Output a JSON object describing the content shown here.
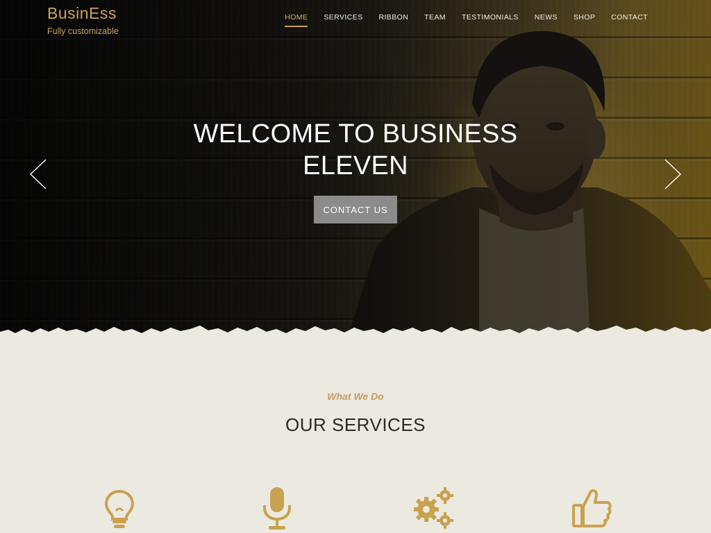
{
  "brand": {
    "title": "BusinEss",
    "tagline": "Fully customizable"
  },
  "nav": {
    "items": [
      {
        "label": "HOME",
        "active": true
      },
      {
        "label": "SERVICES",
        "active": false
      },
      {
        "label": "RIBBON",
        "active": false
      },
      {
        "label": "TEAM",
        "active": false
      },
      {
        "label": "TESTIMONIALS",
        "active": false
      },
      {
        "label": "NEWS",
        "active": false
      },
      {
        "label": "SHOP",
        "active": false
      },
      {
        "label": "CONTACT",
        "active": false
      }
    ]
  },
  "hero": {
    "title_line1": "WELCOME TO BUSINESS",
    "title_line2": "ELEVEN",
    "button_label": "CONTACT US"
  },
  "services": {
    "kicker": "What We Do",
    "title": "OUR SERVICES",
    "icons": [
      "lightbulb-icon",
      "microphone-icon",
      "gears-icon",
      "thumbs-up-icon"
    ]
  },
  "colors": {
    "accent": "#c9a24f",
    "hero_button": "#8b8b8b",
    "section_bg": "#ece9e1",
    "heading": "#2e2a22"
  }
}
